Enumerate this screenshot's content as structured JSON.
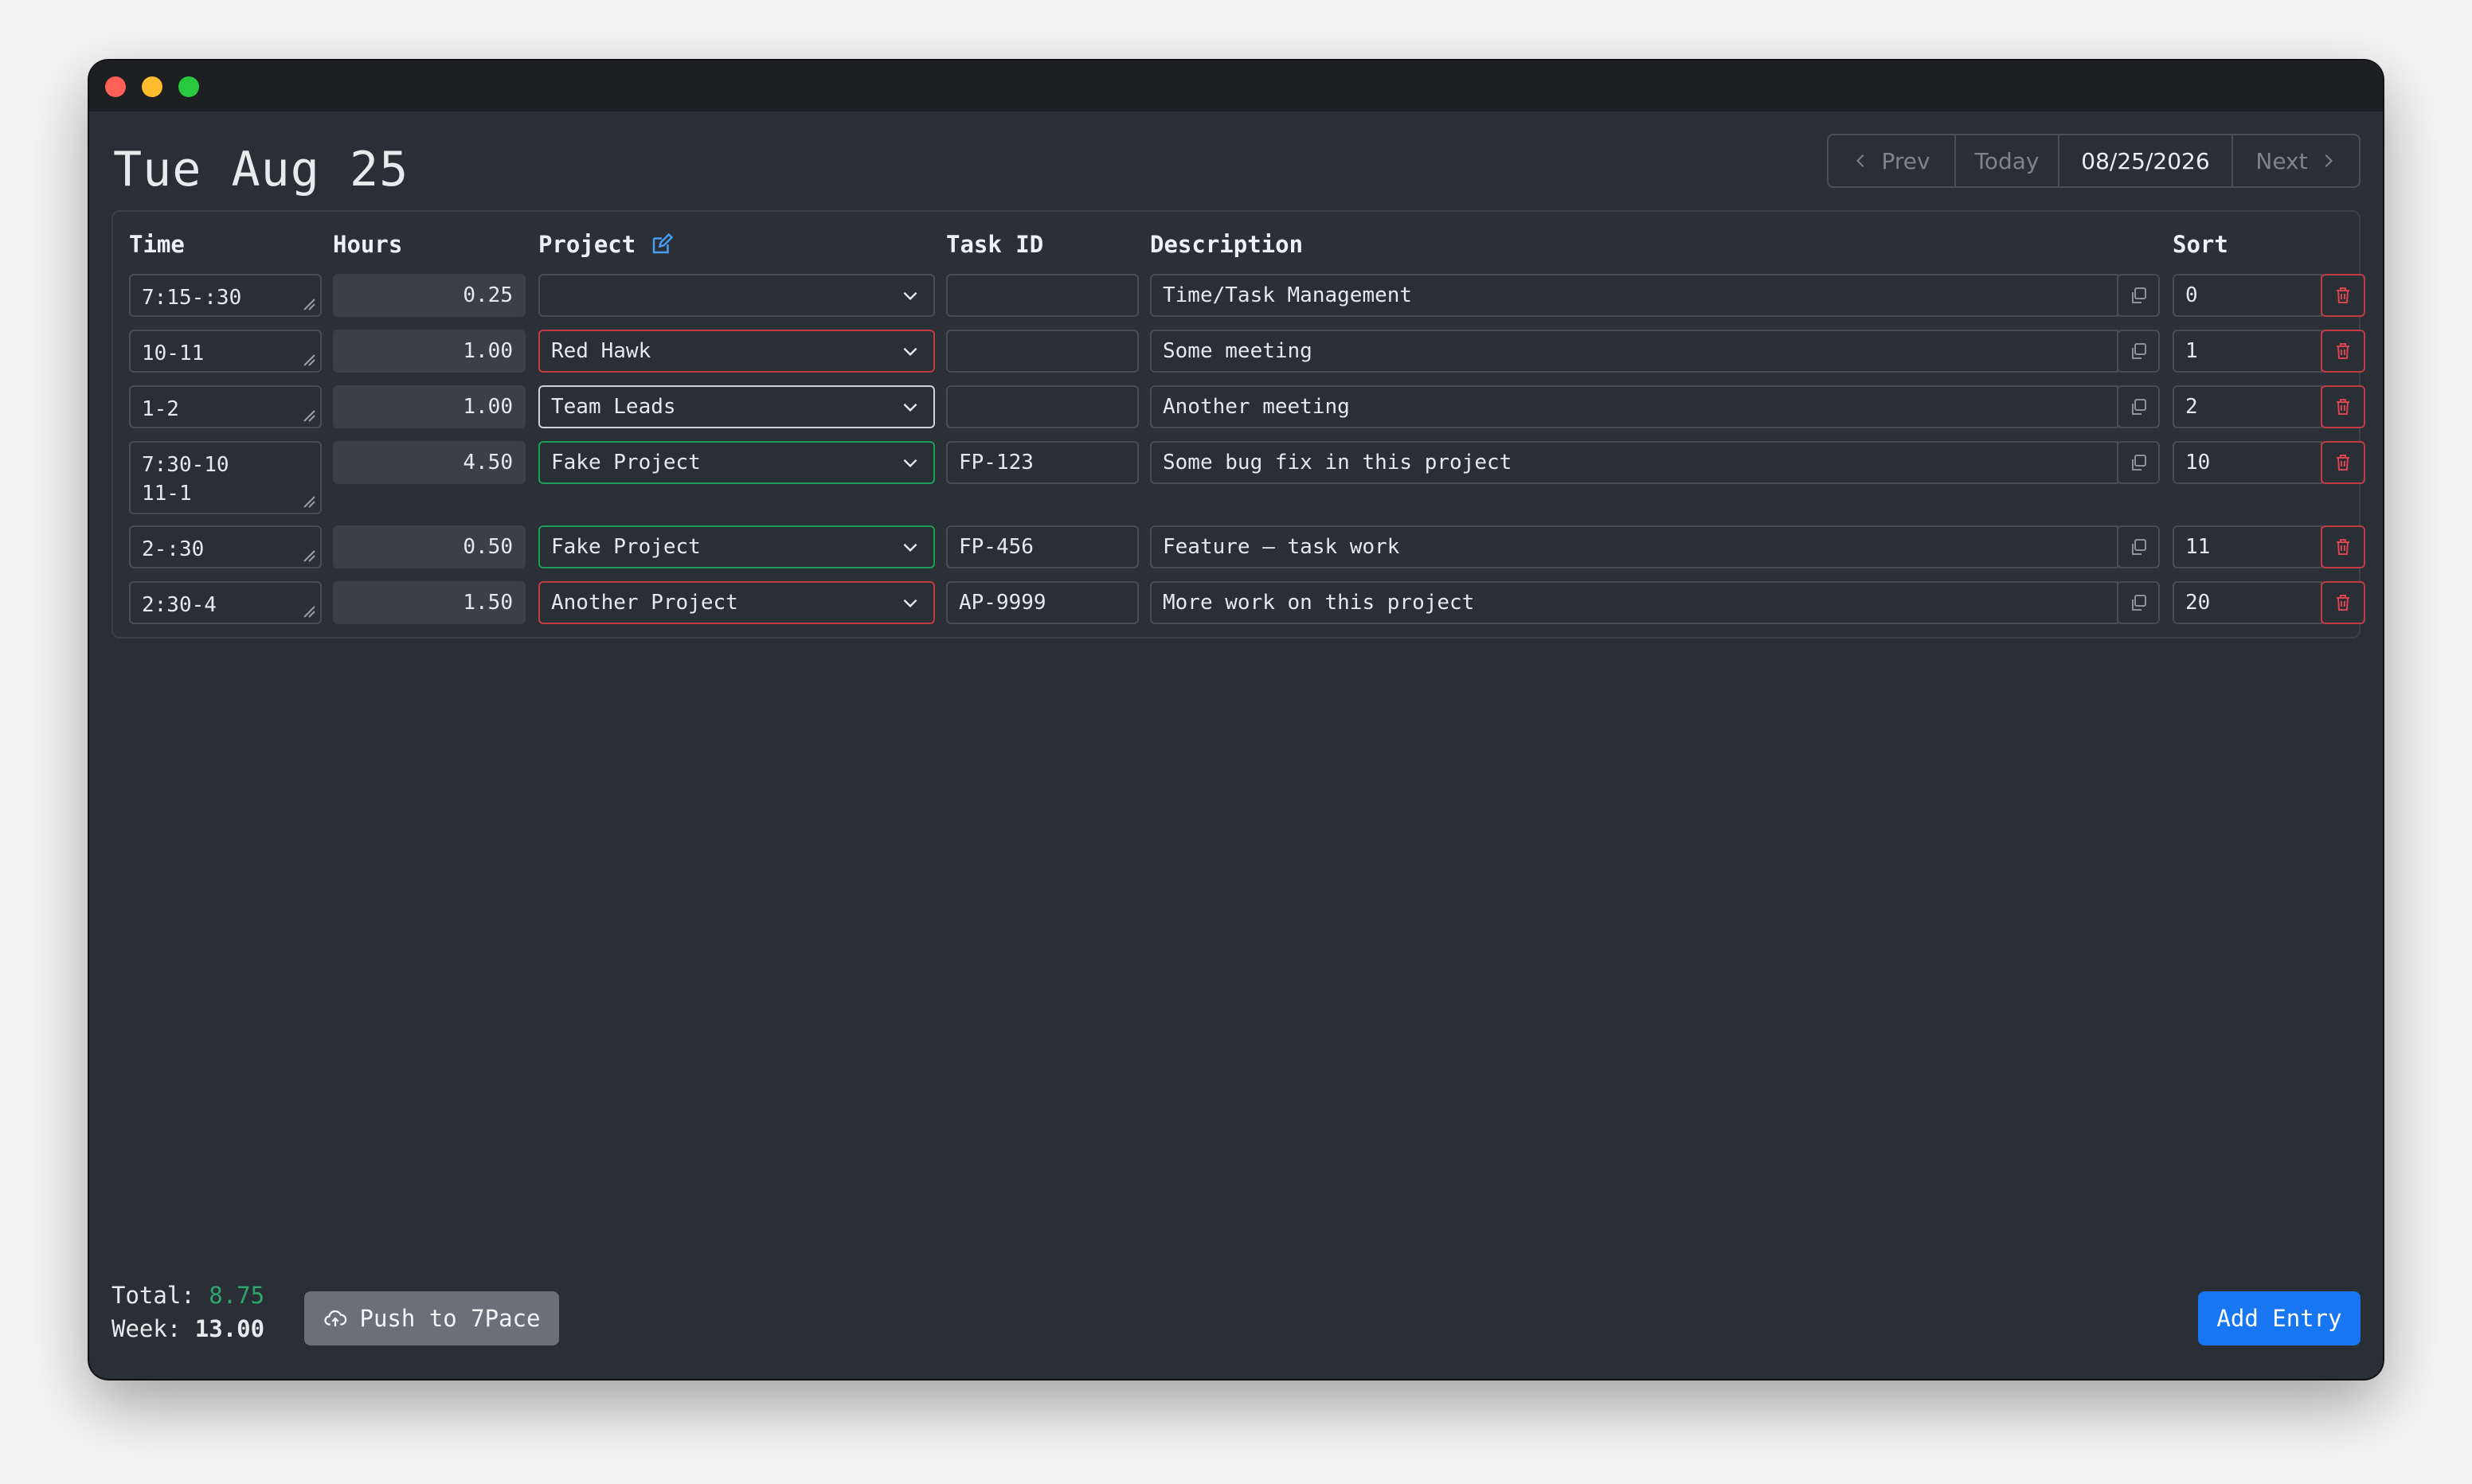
{
  "header": {
    "day_title": "Tue Aug 25",
    "nav": {
      "prev": "Prev",
      "today": "Today",
      "date": "08/25/2026",
      "next": "Next"
    }
  },
  "columns": {
    "time": "Time",
    "hours": "Hours",
    "project": "Project",
    "task_id": "Task ID",
    "description": "Description",
    "sort": "Sort"
  },
  "entries": [
    {
      "time": "7:15-:30",
      "hours": "0.25",
      "project": "",
      "task_id": "",
      "description": "Time/Task Management",
      "sort": "0"
    },
    {
      "time": "10-11",
      "hours": "1.00",
      "project": "Red Hawk",
      "task_id": "",
      "description": "Some meeting",
      "sort": "1"
    },
    {
      "time": "1-2",
      "hours": "1.00",
      "project": "Team Leads",
      "task_id": "",
      "description": "Another meeting",
      "sort": "2"
    },
    {
      "time": "7:30-10\n11-1",
      "hours": "4.50",
      "project": "Fake Project",
      "task_id": "FP-123",
      "description": "Some bug fix in this project",
      "sort": "10"
    },
    {
      "time": "2-:30",
      "hours": "0.50",
      "project": "Fake Project",
      "task_id": "FP-456",
      "description": "Feature – task work",
      "sort": "11"
    },
    {
      "time": "2:30-4",
      "hours": "1.50",
      "project": "Another Project",
      "task_id": "AP-9999",
      "description": "More work on this project",
      "sort": "20"
    }
  ],
  "footer": {
    "total_label": "Total:",
    "total_value": "8.75",
    "week_label": "Week:",
    "week_value": "13.00",
    "push_label": "Push to 7Pace",
    "add_label": "Add Entry"
  },
  "colors": {
    "background": "#2a2e35",
    "accent_blue": "#1976f2",
    "total_green": "#2ea56a",
    "delete_red": "#c23b44",
    "project_green": "#1f9d5b"
  },
  "icons": {
    "edit": "edit-icon",
    "copy": "copy-icon",
    "delete": "trash-icon",
    "dropdown": "chevron-down-icon",
    "push": "cloud-upload-icon"
  }
}
